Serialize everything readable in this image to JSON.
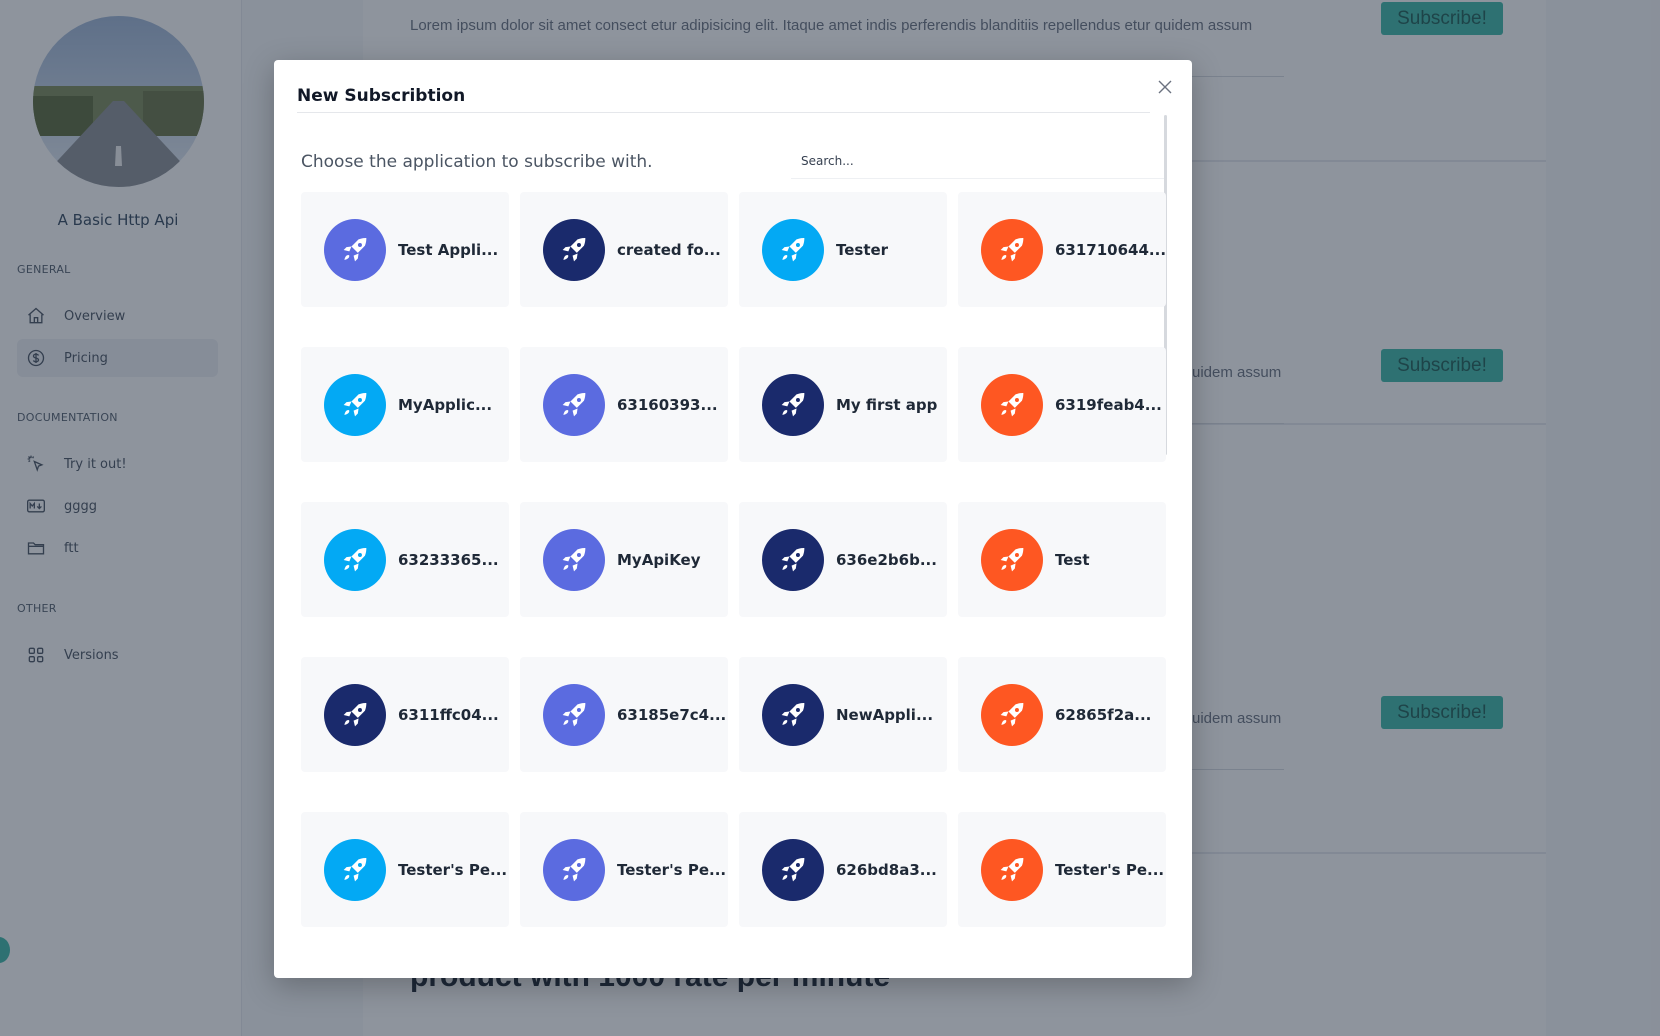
{
  "sidebar": {
    "api_name": "A Basic Http Api",
    "sections": {
      "general": "GENERAL",
      "documentation": "DOCUMENTATION",
      "other": "OTHER"
    },
    "items": {
      "overview": "Overview",
      "pricing": "Pricing",
      "try_it_out": "Try it out!",
      "gggg": "gggg",
      "ftt": "ftt",
      "versions": "Versions"
    }
  },
  "background": {
    "lorem_text": "Lorem ipsum dolor sit amet consect etur adipisicing elit. Itaque amet indis perferendis blanditiis repellendus etur quidem assum",
    "lorem_partial": "uidem assum",
    "subscribe_label": "Subscribe!",
    "product_title": "product with 1000 rate per minute"
  },
  "modal": {
    "title": "New Subscribtion",
    "subtitle": "Choose the application to subscribe with.",
    "search_placeholder": "Search...",
    "applications": [
      {
        "name": "Test Appli...",
        "color": "#5b6be0"
      },
      {
        "name": "created fo...",
        "color": "#1a2a6c"
      },
      {
        "name": "Tester",
        "color": "#03a9f4"
      },
      {
        "name": "631710644...",
        "color": "#fe5722"
      },
      {
        "name": "MyApplic...",
        "color": "#03a9f4"
      },
      {
        "name": "63160393...",
        "color": "#5b6be0"
      },
      {
        "name": "My first app",
        "color": "#1a2a6c"
      },
      {
        "name": "6319feab4...",
        "color": "#fe5722"
      },
      {
        "name": "63233365...",
        "color": "#03a9f4"
      },
      {
        "name": "MyApiKey",
        "color": "#5b6be0"
      },
      {
        "name": "636e2b6b...",
        "color": "#1a2a6c"
      },
      {
        "name": "Test",
        "color": "#fe5722"
      },
      {
        "name": "6311ffc04...",
        "color": "#1a2a6c"
      },
      {
        "name": "63185e7c4...",
        "color": "#5b6be0"
      },
      {
        "name": "NewAppli...",
        "color": "#1a2a6c"
      },
      {
        "name": "62865f2a...",
        "color": "#fe5722"
      },
      {
        "name": "Tester's Pe...",
        "color": "#03a9f4"
      },
      {
        "name": "Tester's Pe...",
        "color": "#5b6be0"
      },
      {
        "name": "626bd8a3...",
        "color": "#1a2a6c"
      },
      {
        "name": "Tester's Pe...",
        "color": "#fe5722"
      }
    ]
  }
}
